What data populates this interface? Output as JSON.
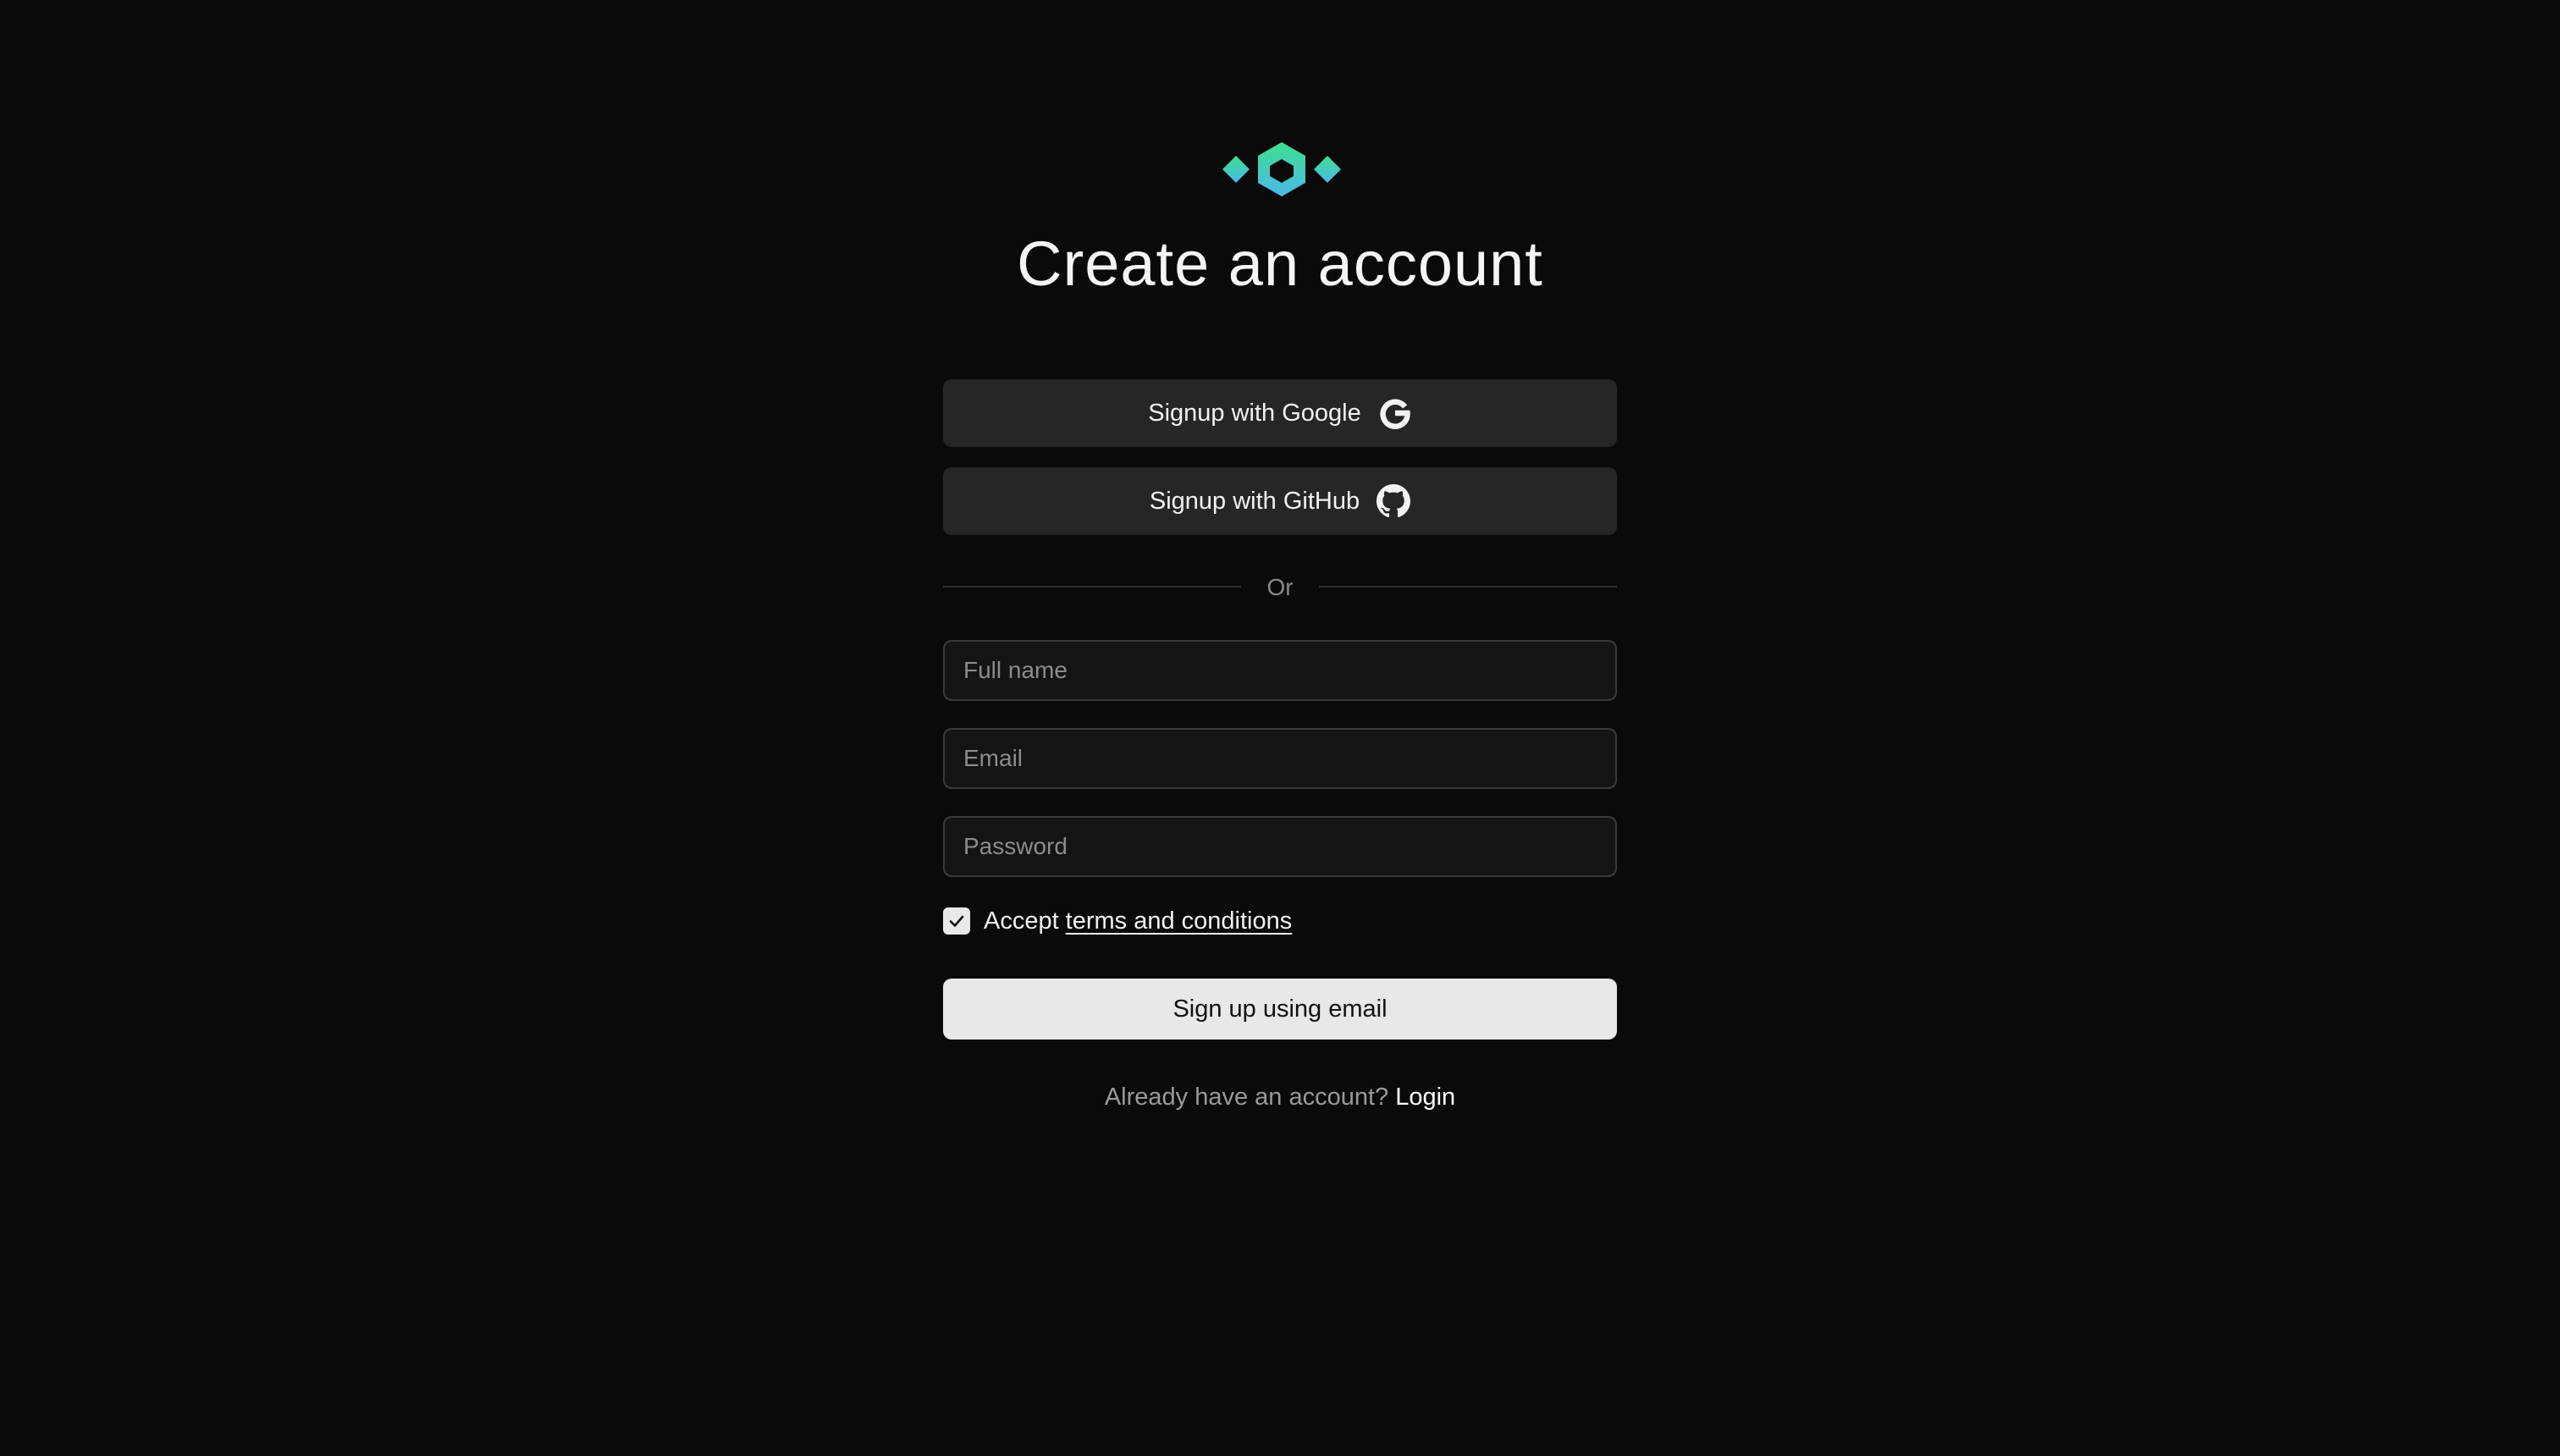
{
  "page": {
    "title": "Create an account"
  },
  "brand": {
    "logo_icon": "hexagon-diamonds-logo-icon",
    "gradient_start": "#3ee08f",
    "gradient_end": "#4bb8e8"
  },
  "oauth": {
    "google_label": "Signup with Google",
    "google_icon": "google-icon",
    "github_label": "Signup with GitHub",
    "github_icon": "github-icon"
  },
  "divider": {
    "label": "Or"
  },
  "form": {
    "full_name_placeholder": "Full name",
    "full_name_value": "",
    "email_placeholder": "Email",
    "email_value": "",
    "password_placeholder": "Password",
    "password_value": "",
    "terms_checked": true,
    "terms_prefix": "Accept",
    "terms_link": "terms and conditions",
    "submit_label": "Sign up using email"
  },
  "footer": {
    "prompt": "Already have an account?",
    "login_label": "Login"
  },
  "colors": {
    "background": "#0a0a0a",
    "button_dark": "#262626",
    "button_light": "#e8e8e8",
    "input_bg": "#141414",
    "input_border": "#3a3a3a"
  }
}
